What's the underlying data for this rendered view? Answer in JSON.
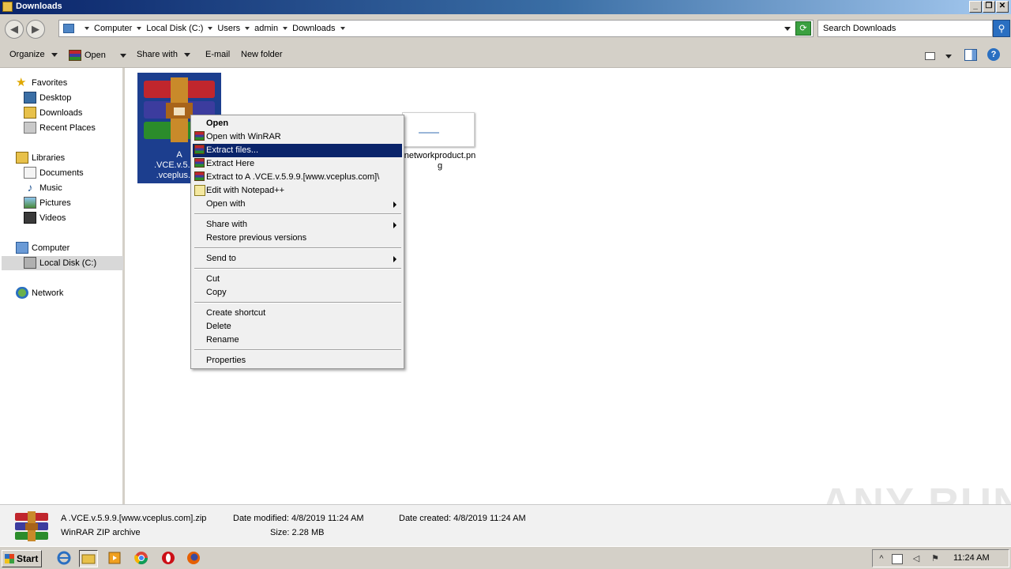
{
  "window": {
    "title": "Downloads"
  },
  "address": {
    "crumbs": [
      "Computer",
      "Local Disk (C:)",
      "Users",
      "admin",
      "Downloads"
    ]
  },
  "search": {
    "placeholder": "Search Downloads"
  },
  "toolbar": {
    "organize": "Organize",
    "open": "Open",
    "share_with": "Share with",
    "email": "E-mail",
    "new_folder": "New folder"
  },
  "sidebar": {
    "favorites": "Favorites",
    "desktop": "Desktop",
    "downloads": "Downloads",
    "recent_places": "Recent Places",
    "libraries": "Libraries",
    "documents": "Documents",
    "music": "Music",
    "pictures": "Pictures",
    "videos": "Videos",
    "computer": "Computer",
    "local_disk": "Local Disk (C:)",
    "network": "Network"
  },
  "files": {
    "selected_line1": "A",
    "selected_line2": ".VCE.v.5.9.9.",
    "selected_line3": ".vceplus.cor",
    "second_line1": "networkproduct.pn",
    "second_line2": "g"
  },
  "context_menu": {
    "open": "Open",
    "open_with_winrar": "Open with WinRAR",
    "extract_files": "Extract files...",
    "extract_here": "Extract Here",
    "extract_to": "Extract to A .VCE.v.5.9.9.[www.vceplus.com]\\",
    "edit_notepad": "Edit with Notepad++",
    "open_with": "Open with",
    "share_with": "Share with",
    "restore_versions": "Restore previous versions",
    "send_to": "Send to",
    "cut": "Cut",
    "copy": "Copy",
    "create_shortcut": "Create shortcut",
    "delete": "Delete",
    "rename": "Rename",
    "properties": "Properties"
  },
  "details": {
    "filename": "A .VCE.v.5.9.9.[www.vceplus.com].zip",
    "type": "WinRAR ZIP archive",
    "date_modified": "Date modified: 4/8/2019 11:24 AM",
    "size": "Size: 2.28 MB",
    "date_created": "Date created: 4/8/2019 11:24 AM"
  },
  "taskbar": {
    "start": "Start",
    "clock": "11:24 AM"
  },
  "watermark": "ANY RUN"
}
